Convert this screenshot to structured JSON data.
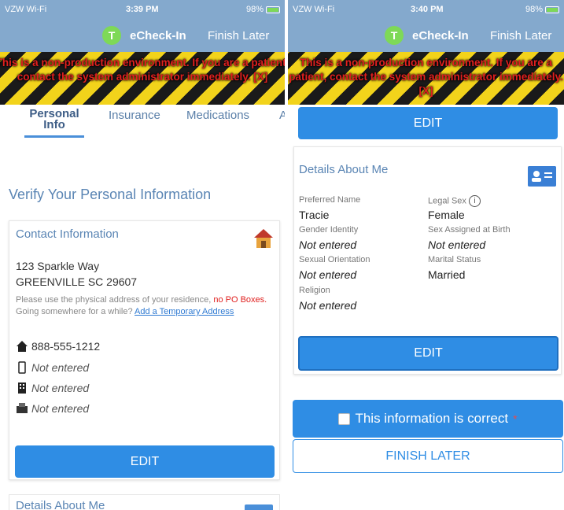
{
  "left": {
    "status": {
      "carrier": "VZW Wi-Fi",
      "time": "3:39 PM",
      "battery": "98%"
    },
    "nav": {
      "title": "eCheck-In",
      "finish": "Finish Later",
      "badge": "T"
    },
    "banner": "This is a non-production environment. If you are a patient, contact the system administrator immediately. [X]",
    "tabs": [
      {
        "label": "Personal Info",
        "active": true
      },
      {
        "label": "Insurance",
        "active": false
      },
      {
        "label": "Medications",
        "active": false
      },
      {
        "label": "A",
        "active": false
      }
    ],
    "heading": "Verify Your Personal Information",
    "contact": {
      "title": "Contact Information",
      "address_line1": "123 Sparkle Way",
      "address_line2": "GREENVILLE SC 29607",
      "note_text": "Please use the physical address of your residence,",
      "note_red": "no PO Boxes.",
      "note_going": "Going somewhere for a while?",
      "note_link": "Add a Temporary Address",
      "home_phone": "888-555-1212",
      "mobile_phone": "Not entered",
      "work_phone": "Not entered",
      "fax": "Not entered"
    },
    "edit_label": "EDIT",
    "details_peek": "Details About Me"
  },
  "right": {
    "status": {
      "carrier": "VZW Wi-Fi",
      "time": "3:40 PM",
      "battery": "98%"
    },
    "nav": {
      "title": "eCheck-In",
      "finish": "Finish Later",
      "badge": "T"
    },
    "banner": "This is a non-production environment. If you are a patient, contact the system administrator immediately. [X]",
    "top_edit": "EDIT",
    "details": {
      "title": "Details About Me",
      "preferred_name_label": "Preferred Name",
      "preferred_name": "Tracie",
      "legal_sex_label": "Legal Sex",
      "legal_sex": "Female",
      "gender_identity_label": "Gender Identity",
      "gender_identity": "Not entered",
      "sex_at_birth_label": "Sex Assigned at Birth",
      "sex_at_birth": "Not entered",
      "sexual_orientation_label": "Sexual Orientation",
      "sexual_orientation": "Not entered",
      "marital_status_label": "Marital Status",
      "marital_status": "Married",
      "religion_label": "Religion",
      "religion": "Not entered"
    },
    "edit_label": "EDIT",
    "correct_label": "This information is correct",
    "required_mark": "*",
    "finish_later": "FINISH LATER"
  },
  "colors": {
    "accent": "#2f8de4",
    "nav": "#84a9cd",
    "banner_text": "#e0201f"
  }
}
